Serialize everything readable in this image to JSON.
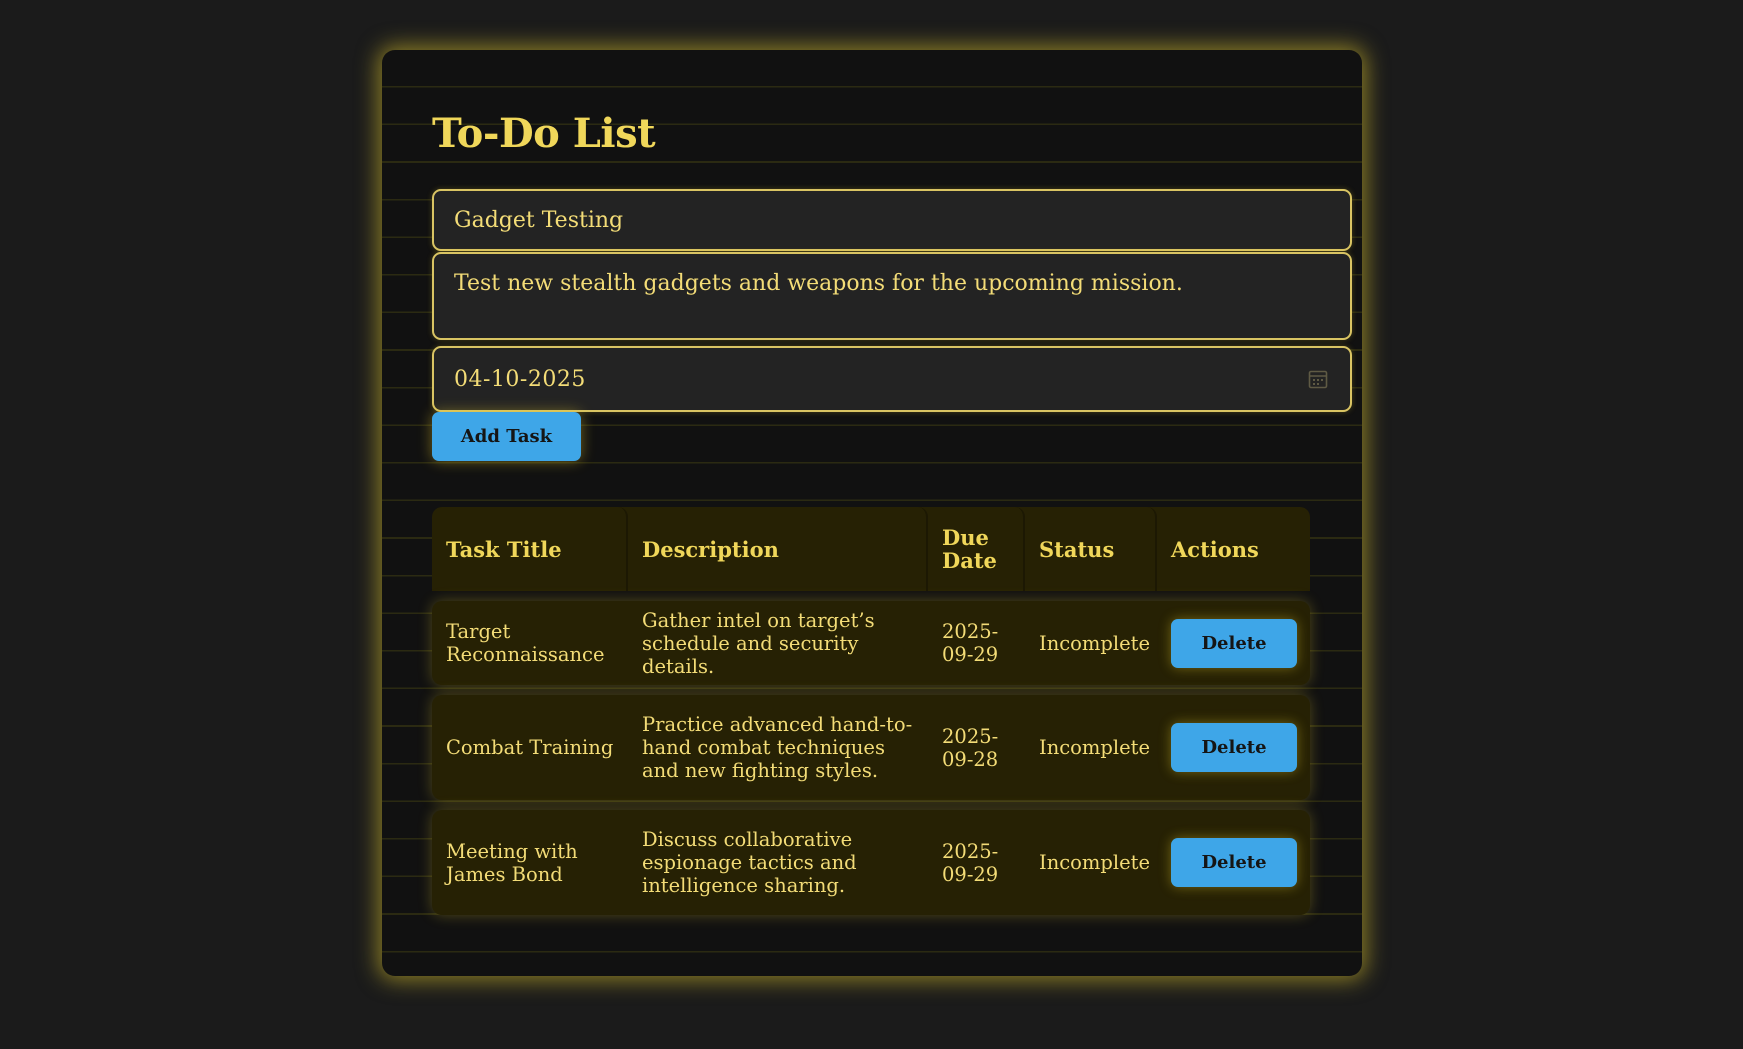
{
  "page": {
    "title": "To-Do List"
  },
  "form": {
    "task_title_value": "Gadget Testing",
    "description_value": "Test new stealth gadgets and weapons for the upcoming mission.",
    "due_date_value": "04-10-2025",
    "add_button_label": "Add Task"
  },
  "table": {
    "headers": {
      "title": "Task Title",
      "description": "Description",
      "due_date": "Due Date",
      "status": "Status",
      "actions": "Actions"
    },
    "rows": [
      {
        "title": "Target Reconnaissance",
        "description": "Gather intel on target’s schedule and security details.",
        "due_date": "2025-09-29",
        "status": "Incomplete",
        "action_label": "Delete"
      },
      {
        "title": "Combat Training",
        "description": "Practice advanced hand-to-hand combat techniques and new fighting styles.",
        "due_date": "2025-09-28",
        "status": "Incomplete",
        "action_label": "Delete"
      },
      {
        "title": "Meeting with James Bond",
        "description": "Discuss collaborative espionage tactics and intelligence sharing.",
        "due_date": "2025-09-29",
        "status": "Incomplete",
        "action_label": "Delete"
      }
    ]
  },
  "icons": {
    "date_picker": "calendar-icon"
  },
  "colors": {
    "background": "#1b1b1b",
    "card": "#111111",
    "accent_gold": "#f0d75a",
    "button_blue": "#3ea6e8",
    "row_bg": "#262104"
  }
}
